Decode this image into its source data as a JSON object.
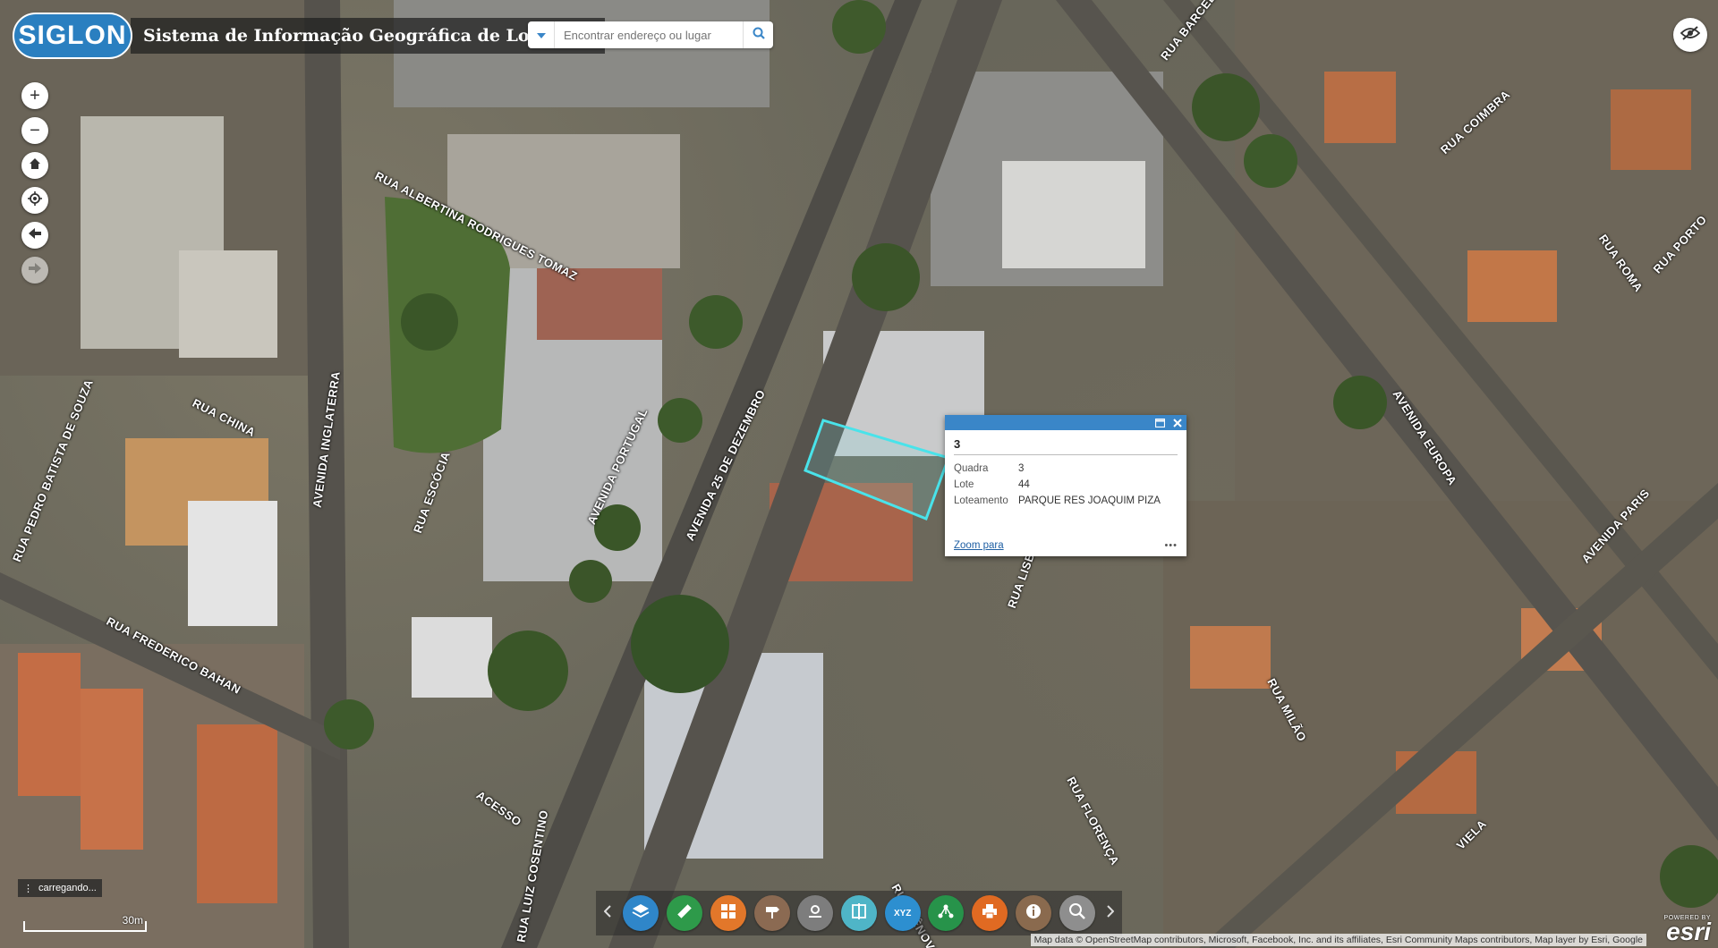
{
  "header": {
    "logo_text": "SIGLON",
    "title": "Sistema de Informação Geográfica de Londrina",
    "search_placeholder": "Encontrar endereço ou lugar"
  },
  "nav": {
    "zoom_in": "+",
    "zoom_out": "−"
  },
  "streets": [
    "RUA BARCELONA",
    "RUA COIMBRA",
    "RUA ROMA",
    "RUA PORTO",
    "RUA ALBERTINA RODRIGUES TOMAZ",
    "RUA CHINA",
    "AVENIDA INGLATERRA",
    "RUA ESCÓCIA",
    "AVENIDA PORTUGAL",
    "AVENIDA 25 DE DEZEMBRO",
    "RUA PEDRO BATISTA DE SOUZA",
    "RUA FREDERICO BAHAN",
    "AVENIDA EUROPA",
    "AVENIDA PARIS",
    "RUA LISBOA",
    "RUA MILÃO",
    "RUA FLORENÇA",
    "VIELA",
    "ACESSO",
    "RUA LUIZ COSENTINO",
    "RUA GÊNOVA"
  ],
  "popup": {
    "title": "3",
    "rows": [
      {
        "key": "Quadra",
        "value": "3"
      },
      {
        "key": "Lote",
        "value": "44"
      },
      {
        "key": "Loteamento",
        "value": "PARQUE RES JOAQUIM PIZA"
      }
    ],
    "zoom_link": "Zoom para",
    "more": "•••"
  },
  "toolbar": {
    "colors": {
      "layers": "#2f86c9",
      "measure": "#2e9a4a",
      "basemap": "#e2772a",
      "directions": "#8b6a52",
      "coordinates": "#7d7d7d",
      "swipe": "#4fb5c7",
      "xyz": "#2d8fd0",
      "share": "#27934a",
      "print": "#e06a22",
      "about": "#8a6a4e",
      "query": "#8e8e8e"
    },
    "xyz_label": "XYZ"
  },
  "status": {
    "loading": "carregando...",
    "scale": "30m"
  },
  "attribution": "Map data © OpenStreetMap contributors, Microsoft, Facebook, Inc. and its affiliates, Esri Community Maps contributors, Map layer by Esri, Google",
  "esri": {
    "powered": "POWERED BY",
    "name": "esri"
  }
}
